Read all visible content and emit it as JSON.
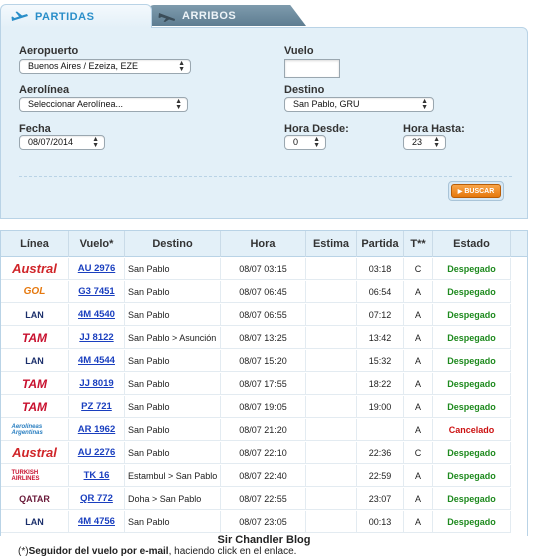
{
  "tabs": [
    {
      "label": "PARTIDAS",
      "icon": "departure-plane-icon",
      "active": true
    },
    {
      "label": "ARRIBOS",
      "icon": "arrival-plane-icon",
      "active": false
    }
  ],
  "search": {
    "aeropuerto_label": "Aeropuerto",
    "aeropuerto_value": "Buenos Aires / Ezeiza, EZE",
    "aerolinea_label": "Aerolínea",
    "aerolinea_value": "Seleccionar Aerolínea...",
    "fecha_label": "Fecha",
    "fecha_value": "08/07/2014",
    "vuelo_label": "Vuelo",
    "vuelo_value": "",
    "destino_label": "Destino",
    "destino_value": "San Pablo, GRU",
    "hora_desde_label": "Hora Desde:",
    "hora_desde_value": "0",
    "hora_hasta_label": "Hora Hasta:",
    "hora_hasta_value": "23",
    "buscar_label": "BUSCAR"
  },
  "table": {
    "headers": [
      "Línea",
      "Vuelo*",
      "Destino",
      "Hora",
      "Estima",
      "Partida",
      "T**",
      "Estado"
    ],
    "rows": [
      {
        "airline": "Austral",
        "logo": "austral-logo",
        "flight": "AU 2976",
        "dest": "San Pablo",
        "hora": "08/07 03:15",
        "estima": "",
        "partida": "03:18",
        "t": "C",
        "estado": "Despegado",
        "status": "ok"
      },
      {
        "airline": "GOL",
        "logo": "gol-logo",
        "flight": "G3 7451",
        "dest": "San Pablo",
        "hora": "08/07 06:45",
        "estima": "",
        "partida": "06:54",
        "t": "A",
        "estado": "Despegado",
        "status": "ok"
      },
      {
        "airline": "LAN",
        "logo": "lan-logo",
        "flight": "4M 4540",
        "dest": "San Pablo",
        "hora": "08/07 06:55",
        "estima": "",
        "partida": "07:12",
        "t": "A",
        "estado": "Despegado",
        "status": "ok"
      },
      {
        "airline": "TAM",
        "logo": "tam-logo",
        "flight": "JJ 8122",
        "dest": "San Pablo > Asunción",
        "hora": "08/07 13:25",
        "estima": "",
        "partida": "13:42",
        "t": "A",
        "estado": "Despegado",
        "status": "ok"
      },
      {
        "airline": "LAN",
        "logo": "lan-logo",
        "flight": "4M 4544",
        "dest": "San Pablo",
        "hora": "08/07 15:20",
        "estima": "",
        "partida": "15:32",
        "t": "A",
        "estado": "Despegado",
        "status": "ok"
      },
      {
        "airline": "TAM",
        "logo": "tam-logo",
        "flight": "JJ 8019",
        "dest": "San Pablo",
        "hora": "08/07 17:55",
        "estima": "",
        "partida": "18:22",
        "t": "A",
        "estado": "Despegado",
        "status": "ok"
      },
      {
        "airline": "TAM",
        "logo": "tam-logo",
        "flight": "PZ 721",
        "dest": "San Pablo",
        "hora": "08/07 19:05",
        "estima": "",
        "partida": "19:00",
        "t": "A",
        "estado": "Despegado",
        "status": "ok"
      },
      {
        "airline": "Aerolíneas Argentinas",
        "logo": "aerolineas-argentinas-logo",
        "flight": "AR 1962",
        "dest": "San Pablo",
        "hora": "08/07 21:20",
        "estima": "",
        "partida": "",
        "t": "A",
        "estado": "Cancelado",
        "status": "bad"
      },
      {
        "airline": "Austral",
        "logo": "austral-logo",
        "flight": "AU 2276",
        "dest": "San Pablo",
        "hora": "08/07 22:10",
        "estima": "",
        "partida": "22:36",
        "t": "C",
        "estado": "Despegado",
        "status": "ok"
      },
      {
        "airline": "TURKISH AIRLINES",
        "logo": "turkish-airlines-logo",
        "flight": "TK 16",
        "dest": "Estambul > San Pablo",
        "hora": "08/07 22:40",
        "estima": "",
        "partida": "22:59",
        "t": "A",
        "estado": "Despegado",
        "status": "ok"
      },
      {
        "airline": "QATAR",
        "logo": "qatar-logo",
        "flight": "QR 772",
        "dest": "Doha > San Pablo",
        "hora": "08/07 22:55",
        "estima": "",
        "partida": "23:07",
        "t": "A",
        "estado": "Despegado",
        "status": "ok"
      },
      {
        "airline": "LAN",
        "logo": "lan-logo",
        "flight": "4M 4756",
        "dest": "San Pablo",
        "hora": "08/07 23:05",
        "estima": "",
        "partida": "00:13",
        "t": "A",
        "estado": "Despegado",
        "status": "ok"
      }
    ]
  },
  "footer": {
    "title": "Sir Chandler Blog",
    "note_prefix": "(*)",
    "note_bold": "Seguidor del vuelo por e-mail",
    "note_rest": ", haciendo click en el enlace."
  },
  "colors": {
    "panel_bg": "#e3f0f8",
    "link": "#1a3fbf",
    "ok": "#1e8a1e",
    "cancel": "#cc1111",
    "accent_orange": "#e5780e"
  }
}
